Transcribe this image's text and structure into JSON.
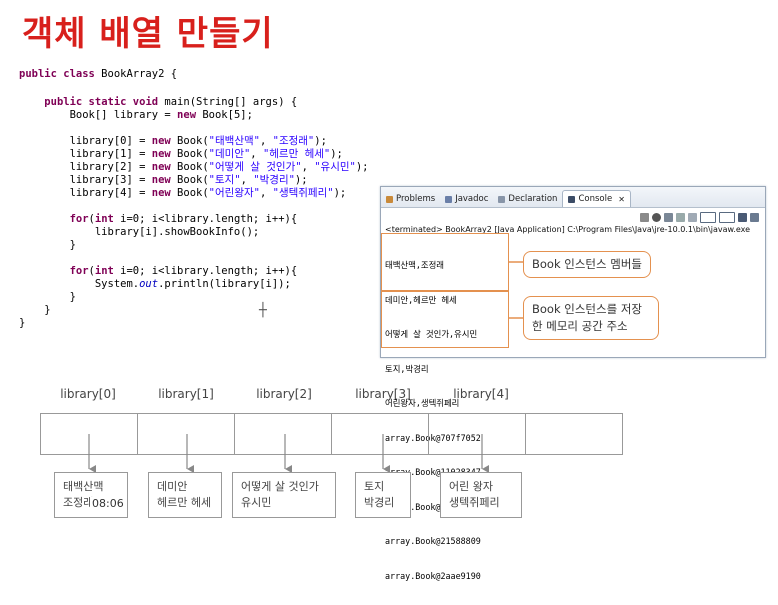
{
  "slide_title": "객체 배열 만들기",
  "eclipse": {
    "tabs": [
      "Problems",
      "Javadoc",
      "Declaration",
      "Console"
    ],
    "active_tab": "Console",
    "terminated": "<terminated> BookArray2 [Java Application] C:\\Program Files\\Java\\jre-10.0.1\\bin\\javaw.exe",
    "output_members": [
      "태백산맥,조정래",
      "데미안,헤르만 헤세",
      "어떻게 살 것인가,유시민",
      "토지,박경리",
      "어린왕자,생텍쥐페리"
    ],
    "output_addresses": [
      "array.Book@707f7052",
      "array.Book@11028347",
      "array.Book@14899482",
      "array.Book@21588809",
      "array.Book@2aae9190"
    ],
    "callout_members": "Book 인스턴스 멤버들",
    "callout_address": "Book 인스턴스를 저장한 메모리 공간 주소"
  },
  "diagram": {
    "labels": [
      "library[0]",
      "library[1]",
      "library[2]",
      "library[3]",
      "library[4]"
    ],
    "books": [
      {
        "title": "태백산맥",
        "author": "조정래"
      },
      {
        "title": "데미안",
        "author": "헤르만 헤세"
      },
      {
        "title": "어떻게 살 것인가",
        "author": "유시민"
      },
      {
        "title": "토지",
        "author": "박경리"
      },
      {
        "title": "어린 왕자",
        "author": "생텍쥐페리"
      }
    ]
  },
  "timestamp": "08:06"
}
